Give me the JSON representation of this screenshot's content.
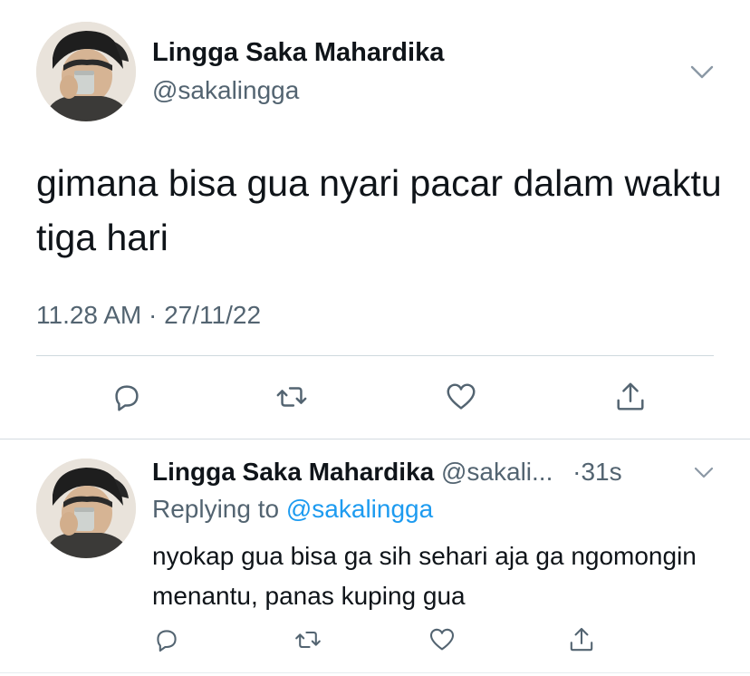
{
  "main_tweet": {
    "author_name": "Lingga Saka Mahardika",
    "author_handle": "@sakalingga",
    "text": "gimana bisa gua nyari pacar dalam waktu tiga hari",
    "meta": "11.28 AM · 27/11/22"
  },
  "reply_tweet": {
    "author_name": "Lingga Saka Mahardika",
    "author_handle": "@sakali...",
    "time": "·31s",
    "replying_prefix": "Replying to",
    "replying_to": "@sakalingga",
    "text": "nyokap gua bisa ga sih sehari aja ga ngomongin menantu, panas kuping gua"
  },
  "icons": {
    "reply": "speech-bubble-icon",
    "retweet": "retweet-icon",
    "like": "heart-icon",
    "share": "share-icon",
    "more": "chevron-down-icon"
  },
  "colors": {
    "text": "#0f1419",
    "secondary": "#536471",
    "link": "#1d9bf0",
    "divider": "#cfd9de"
  }
}
